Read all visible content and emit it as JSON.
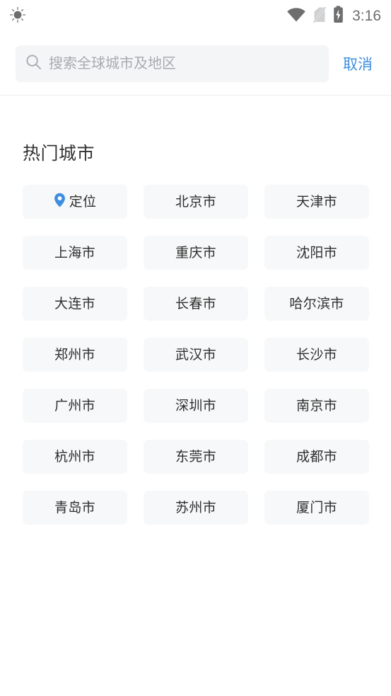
{
  "status_bar": {
    "brightness_icon": "sun-icon",
    "wifi_icon": "wifi-icon",
    "signal_icon": "no-sim-icon",
    "battery_icon": "battery-charging-icon",
    "time": "3:16",
    "icon_color": "#6e6e6e"
  },
  "search": {
    "icon": "search-icon",
    "value": "",
    "placeholder": "搜索全球城市及地区",
    "cancel_label": "取消",
    "cancel_color": "#3e8ee0",
    "field_bg": "#f4f5f7"
  },
  "main": {
    "section_title": "热门城市",
    "chip_bg": "#f7f8f9",
    "accent_color": "#3e8ee0",
    "cities": [
      {
        "label": "定位",
        "icon": "location-pin-icon"
      },
      {
        "label": "北京市",
        "icon": null
      },
      {
        "label": "天津市",
        "icon": null
      },
      {
        "label": "上海市",
        "icon": null
      },
      {
        "label": "重庆市",
        "icon": null
      },
      {
        "label": "沈阳市",
        "icon": null
      },
      {
        "label": "大连市",
        "icon": null
      },
      {
        "label": "长春市",
        "icon": null
      },
      {
        "label": "哈尔滨市",
        "icon": null
      },
      {
        "label": "郑州市",
        "icon": null
      },
      {
        "label": "武汉市",
        "icon": null
      },
      {
        "label": "长沙市",
        "icon": null
      },
      {
        "label": "广州市",
        "icon": null
      },
      {
        "label": "深圳市",
        "icon": null
      },
      {
        "label": "南京市",
        "icon": null
      },
      {
        "label": "杭州市",
        "icon": null
      },
      {
        "label": "东莞市",
        "icon": null
      },
      {
        "label": "成都市",
        "icon": null
      },
      {
        "label": "青岛市",
        "icon": null
      },
      {
        "label": "苏州市",
        "icon": null
      },
      {
        "label": "厦门市",
        "icon": null
      }
    ]
  }
}
